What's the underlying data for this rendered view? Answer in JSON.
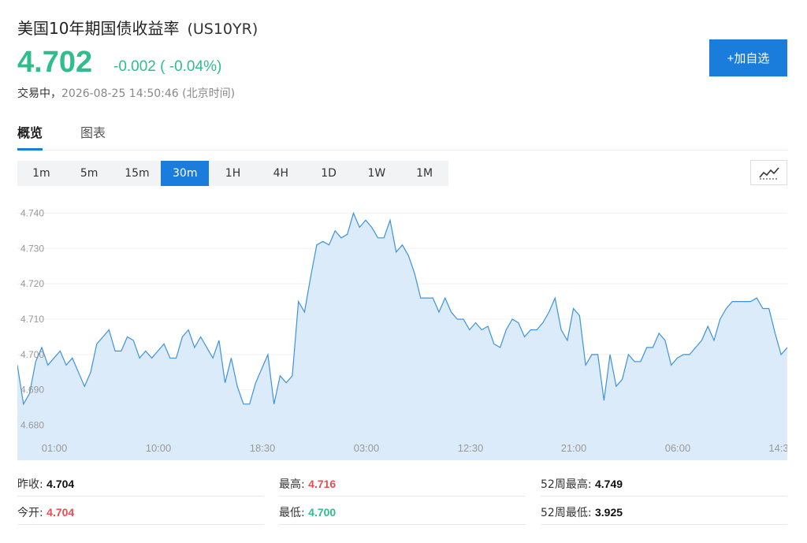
{
  "header": {
    "title": "美国10年期国债收益率",
    "code": "(US10YR)",
    "price": "4.702",
    "change": "-0.002 ( -0.04%)",
    "status": "交易中，",
    "timestamp": "2026-08-25 14:50:46 (北京时间)",
    "add_label": "+加自选"
  },
  "tabs": [
    {
      "label": "概览",
      "active": true
    },
    {
      "label": "图表",
      "active": false
    }
  ],
  "periods": [
    {
      "label": "1m"
    },
    {
      "label": "5m"
    },
    {
      "label": "15m"
    },
    {
      "label": "30m",
      "active": true
    },
    {
      "label": "1H"
    },
    {
      "label": "4H"
    },
    {
      "label": "1D"
    },
    {
      "label": "1W"
    },
    {
      "label": "1M"
    }
  ],
  "chart_type_icon": "line-chart-icon",
  "colors": {
    "accent": "#1a7ddc",
    "down": "#2fbd8c",
    "up": "#e84e4e",
    "line": "#3c93dc",
    "fill": "#dcebfa"
  },
  "chart_data": {
    "type": "area",
    "ylim": [
      4.675,
      4.745
    ],
    "y_ticks": [
      "4.740",
      "4.730",
      "4.720",
      "4.710",
      "4.700",
      "4.690",
      "4.680"
    ],
    "x_ticks": [
      "01:00",
      "10:00",
      "18:30",
      "03:00",
      "12:30",
      "21:00",
      "06:00",
      "14:3"
    ],
    "values": [
      4.697,
      4.686,
      4.689,
      4.698,
      4.702,
      4.697,
      4.699,
      4.701,
      4.697,
      4.699,
      4.695,
      4.691,
      4.695,
      4.703,
      4.705,
      4.707,
      4.701,
      4.701,
      4.705,
      4.704,
      4.699,
      4.701,
      4.699,
      4.701,
      4.703,
      4.699,
      4.699,
      4.705,
      4.707,
      4.702,
      4.705,
      4.702,
      4.699,
      4.704,
      4.692,
      4.699,
      4.691,
      4.686,
      4.686,
      4.692,
      4.696,
      4.7,
      4.686,
      4.694,
      4.692,
      4.694,
      4.715,
      4.712,
      4.722,
      4.731,
      4.732,
      4.731,
      4.735,
      4.733,
      4.734,
      4.74,
      4.736,
      4.738,
      4.736,
      4.733,
      4.733,
      4.738,
      4.729,
      4.731,
      4.728,
      4.723,
      4.716,
      4.716,
      4.716,
      4.712,
      4.716,
      4.712,
      4.71,
      4.71,
      4.707,
      4.709,
      4.707,
      4.708,
      4.703,
      4.702,
      4.707,
      4.71,
      4.709,
      4.705,
      4.707,
      4.707,
      4.709,
      4.712,
      4.716,
      4.707,
      4.704,
      4.713,
      4.711,
      4.697,
      4.7,
      4.7,
      4.687,
      4.7,
      4.691,
      4.693,
      4.7,
      4.698,
      4.698,
      4.702,
      4.702,
      4.706,
      4.704,
      4.697,
      4.699,
      4.7,
      4.7,
      4.702,
      4.704,
      4.708,
      4.704,
      4.71,
      4.713,
      4.715,
      4.715,
      4.715,
      4.715,
      4.716,
      4.713,
      4.713,
      4.706,
      4.7,
      4.702
    ]
  },
  "stats": {
    "prev_close_label": "昨收:",
    "prev_close": "4.704",
    "open_label": "今开:",
    "open": "4.704",
    "high_label": "最高:",
    "high": "4.716",
    "low_label": "最低:",
    "low": "4.700",
    "w52_high_label": "52周最高:",
    "w52_high": "4.749",
    "w52_low_label": "52周最低:",
    "w52_low": "3.925"
  }
}
